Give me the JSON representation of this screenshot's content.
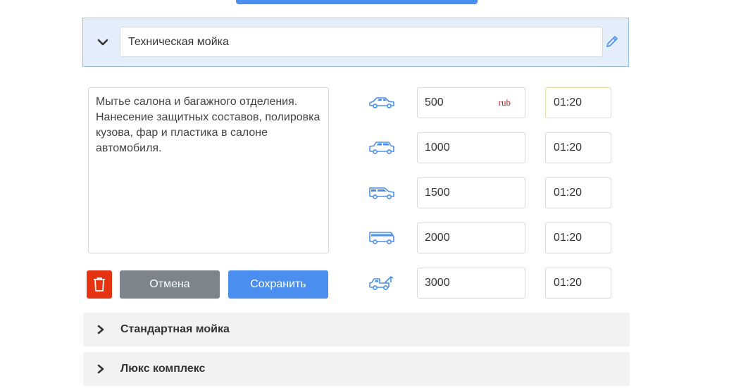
{
  "section": {
    "title_value": "Техническая мойка",
    "description": "Мытье салона и багажного отделения. Нанесение защитных составов, полировка кузова, фар и пластика в салоне автомобиля.",
    "buttons": {
      "cancel": "Отмена",
      "save": "Сохранить"
    },
    "currency": "rub",
    "rows": [
      {
        "icon": "sedan-car-icon",
        "price": "500",
        "time": "01:20"
      },
      {
        "icon": "suv-car-icon",
        "price": "1000",
        "time": "01:20"
      },
      {
        "icon": "crossover-car-icon",
        "price": "1500",
        "time": "01:20"
      },
      {
        "icon": "minibus-icon",
        "price": "2000",
        "time": "01:20"
      },
      {
        "icon": "tow-truck-icon",
        "price": "3000",
        "time": "01:20"
      }
    ]
  },
  "other_sections": [
    {
      "title": "Стандартная мойка"
    },
    {
      "title": "Люкс комплекс"
    }
  ],
  "colors": {
    "accent": "#4a8ff0",
    "delete": "#e63312",
    "cancel": "#7c848c",
    "header_bg": "#e4eefa",
    "currency": "#d01818"
  }
}
